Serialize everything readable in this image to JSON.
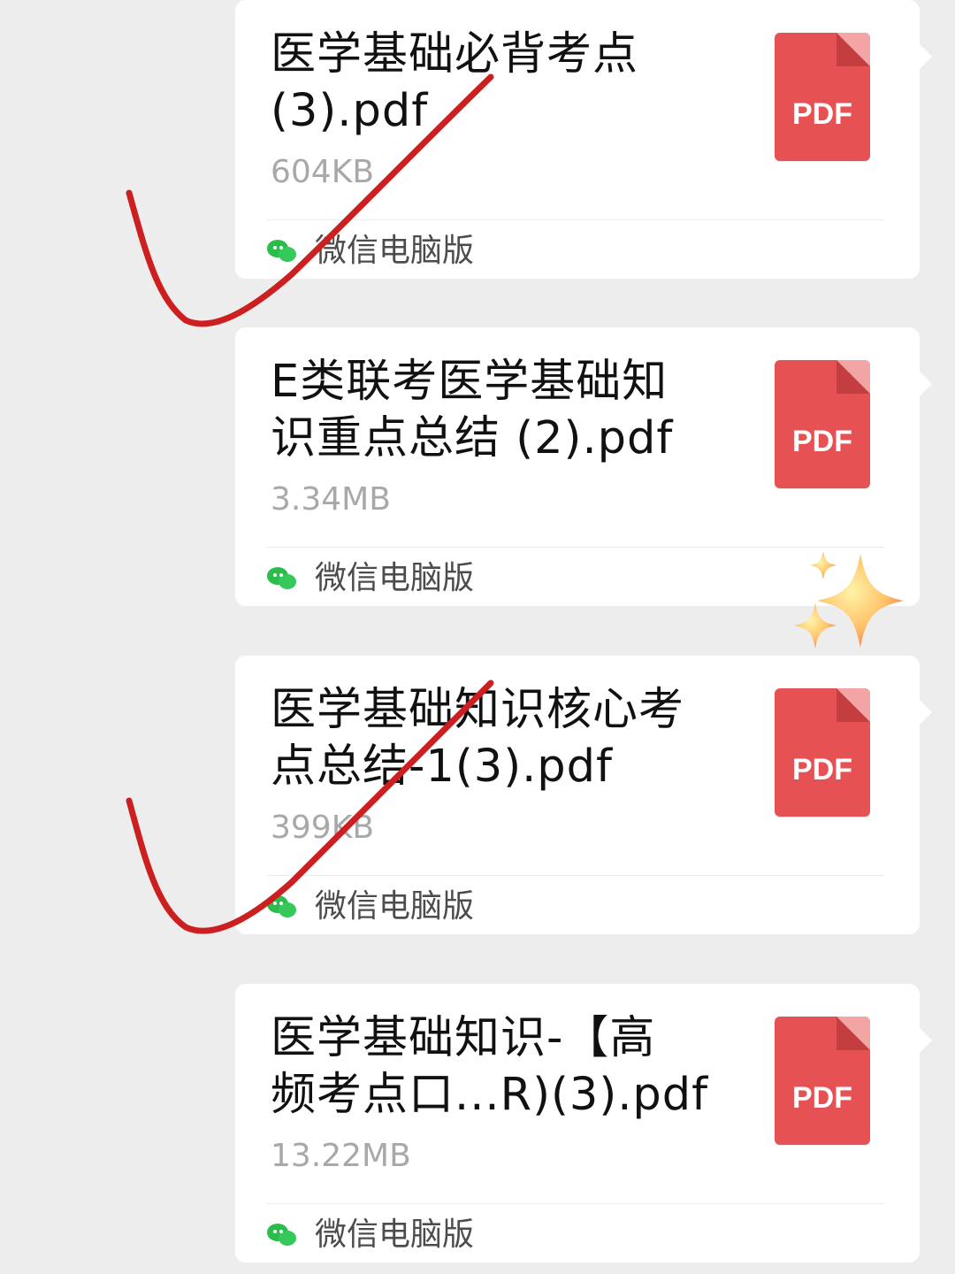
{
  "messages": [
    {
      "title": "医学基础必背考点\n(3).pdf",
      "size": "604KB",
      "file_icon_label": "PDF",
      "source": "微信电脑版"
    },
    {
      "title": "E类联考医学基础知\n识重点总结 (2).pdf",
      "size": "3.34MB",
      "file_icon_label": "PDF",
      "source": "微信电脑版"
    },
    {
      "title": "医学基础知识核心考\n点总结-1(3).pdf",
      "size": "399KB",
      "file_icon_label": "PDF",
      "source": "微信电脑版"
    },
    {
      "title": "医学基础知识-【高\n频考点口...R)(3).pdf",
      "size": "13.22MB",
      "file_icon_label": "PDF",
      "source": "微信电脑版"
    }
  ],
  "colors": {
    "background": "#ededed",
    "bubble": "#ffffff",
    "pdf_red": "#e65254",
    "wechat_green": "#2bbd4b",
    "check_red": "#cc1f1f"
  },
  "icons": {
    "file": "pdf-icon",
    "source": "wechat-icon",
    "decoration": "sparkle-icon"
  }
}
